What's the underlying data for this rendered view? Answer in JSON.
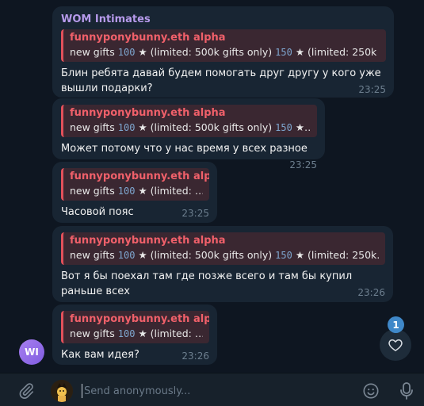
{
  "messages": [
    {
      "sender": "WOM Intimates",
      "reply_title": "funnyponybunny.eth alpha",
      "reply_parts": [
        "new gifts ",
        "100",
        " ★ (limited: 500k gifts only) ",
        "150",
        " ★ (limited: 250k …"
      ],
      "text": "Блин ребята давай будем помогать друг другу у кого уже вышли подарки?",
      "time": "23:25"
    },
    {
      "reply_title": "funnyponybunny.eth alpha",
      "reply_parts": [
        "new gifts ",
        "100",
        " ★ (limited: 500k gifts only) ",
        "150",
        " ★…"
      ],
      "text": "Может потому что у нас время у всех разное",
      "time": "23:25"
    },
    {
      "reply_title": "funnyponybunny.eth alpha",
      "reply_parts": [
        "new gifts ",
        "100",
        " ★ (limited: …"
      ],
      "text": "Часовой пояс",
      "time": "23:25"
    },
    {
      "reply_title": "funnyponybunny.eth alpha",
      "reply_parts": [
        "new gifts ",
        "100",
        " ★ (limited: 500k gifts only) ",
        "150",
        " ★ (limited: 250k…"
      ],
      "text": "Вот я бы поехал там где позже всего и там бы купил раньше всех",
      "time": "23:26"
    },
    {
      "reply_title": "funnyponybunny.eth alpha",
      "reply_parts": [
        "new gifts ",
        "100",
        " ★ (limited: …"
      ],
      "text": "Как вам идея?",
      "time": "23:26"
    }
  ],
  "sender_avatar_initials": "WI",
  "reaction_count": "1",
  "composer": {
    "placeholder": "Send anonymously..."
  },
  "colors": {
    "bubble": "#182533",
    "background": "#0e1621",
    "sender": "#b69aeb",
    "reply_accent": "#e2505a"
  },
  "icons": [
    "paperclip-icon",
    "heart-icon",
    "emoji-icon",
    "microphone-icon"
  ]
}
